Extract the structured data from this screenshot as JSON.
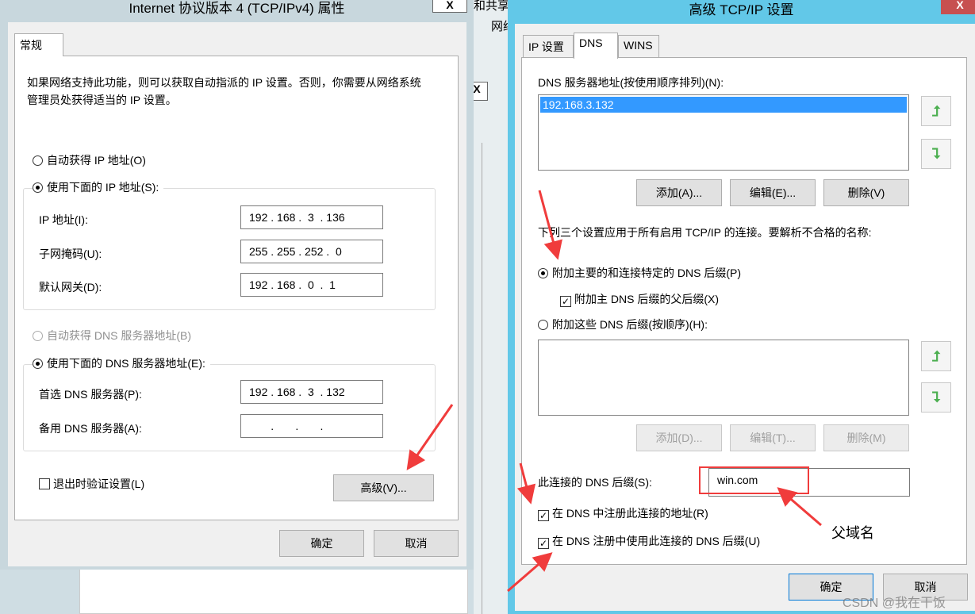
{
  "left_window": {
    "title": "Internet 协议版本 4 (TCP/IPv4) 属性",
    "close": "X",
    "tab": "常规",
    "description": "如果网络支持此功能，则可以获取自动指派的 IP 设置。否则，你需要从网络系统管理员处获得适当的 IP 设置。",
    "auto_ip": "自动获得 IP 地址(O)",
    "manual_ip": "使用下面的 IP 地址(S):",
    "ip_label": "IP 地址(I):",
    "ip_value": "192 . 168 .  3  . 136",
    "mask_label": "子网掩码(U):",
    "mask_value": "255 . 255 . 252 .  0",
    "gw_label": "默认网关(D):",
    "gw_value": "192 . 168 .  0  .  1",
    "auto_dns": "自动获得 DNS 服务器地址(B)",
    "manual_dns": "使用下面的 DNS 服务器地址(E):",
    "dns1_label": "首选 DNS 服务器(P):",
    "dns1_value": "192 . 168 .  3  . 132",
    "dns2_label": "备用 DNS 服务器(A):",
    "dns2_value": "       .       .       .",
    "validate": "退出时验证设置(L)",
    "advanced": "高级(V)...",
    "ok": "确定",
    "cancel": "取消"
  },
  "background": {
    "text1": "和共享",
    "text2": "网络",
    "close": "X"
  },
  "right_window": {
    "title": "高级 TCP/IP 设置",
    "close": "X",
    "tabs": [
      "IP 设置",
      "DNS",
      "WINS"
    ],
    "dns_list_label": "DNS 服务器地址(按使用顺序排列)(N):",
    "dns_list": [
      "192.168.3.132"
    ],
    "add": "添加(A)...",
    "edit": "编辑(E)...",
    "remove": "删除(V)",
    "resolve_text": "下列三个设置应用于所有启用 TCP/IP 的连接。要解析不合格的名称:",
    "append_primary": "附加主要的和连接特定的 DNS 后缀(P)",
    "append_parent": "附加主 DNS 后缀的父后缀(X)",
    "append_these": "附加这些 DNS 后缀(按顺序)(H):",
    "add2": "添加(D)...",
    "edit2": "编辑(T)...",
    "remove2": "删除(M)",
    "suffix_label": "此连接的 DNS 后缀(S):",
    "suffix_value": "win.com",
    "register": "在 DNS 中注册此连接的地址(R)",
    "use_suffix": "在 DNS 注册中使用此连接的 DNS 后缀(U)",
    "ok": "确定",
    "cancel": "取消",
    "up_icon": "arrow-up-icon",
    "down_icon": "arrow-down-icon"
  },
  "annotation": {
    "label": "父域名",
    "accent": "#f03c3c"
  },
  "watermark": "CSDN @我在干饭"
}
